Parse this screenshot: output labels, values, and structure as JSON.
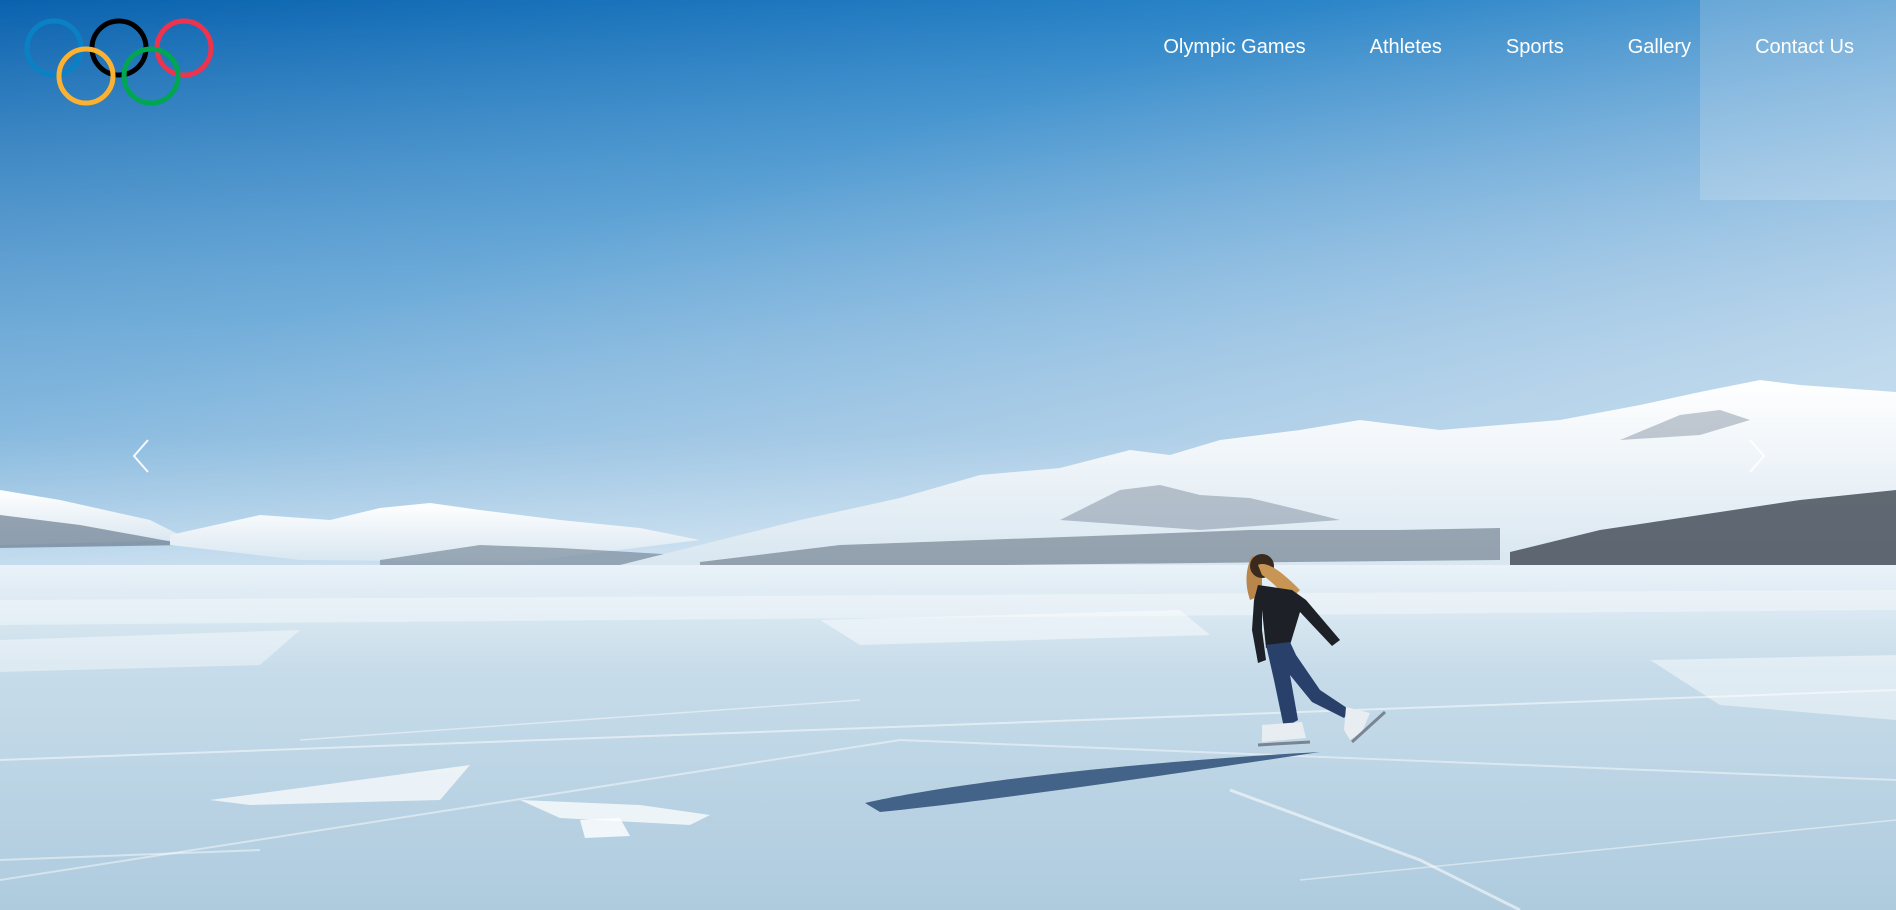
{
  "brand": {
    "logo": "olympic-rings",
    "ring_colors": [
      "#0b81c5",
      "#000000",
      "#ee334e",
      "#fcb131",
      "#00a651"
    ]
  },
  "nav": {
    "items": [
      {
        "label": "Olympic Games"
      },
      {
        "label": "Athletes"
      },
      {
        "label": "Sports"
      },
      {
        "label": "Gallery"
      },
      {
        "label": "Contact Us"
      }
    ]
  },
  "hero": {
    "image": "frozen-lake-skater",
    "prev_icon": "chevron-left-icon",
    "next_icon": "chevron-right-icon"
  },
  "colors": {
    "nav_text": "#ffffff",
    "sky_top": "#0b6cb8",
    "sky_bottom": "#cfe1ef",
    "ice": "#c5dced"
  }
}
